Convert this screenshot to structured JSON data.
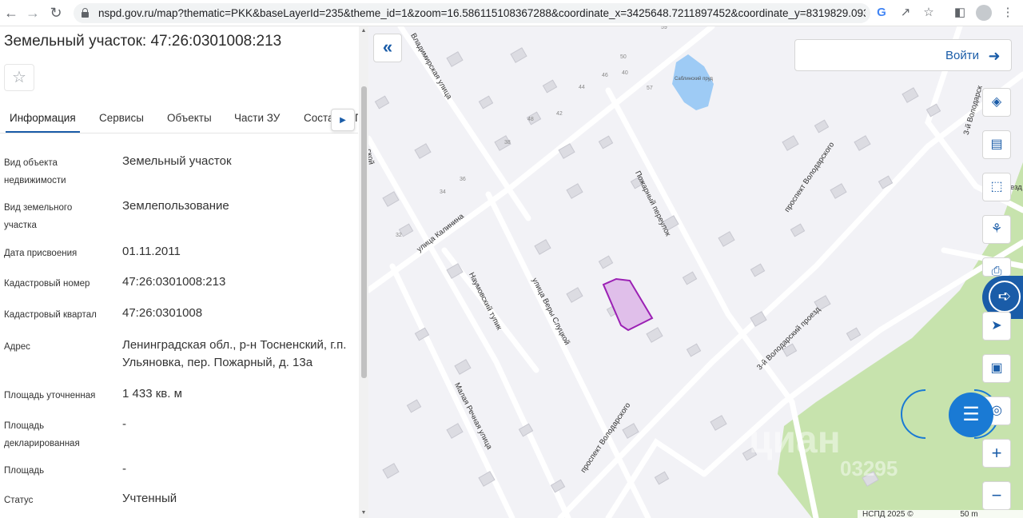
{
  "browser": {
    "url": "nspd.gov.ru/map?thematic=PKK&baseLayerId=235&theme_id=1&zoom=16.586115108367288&coordinate_x=3425648.7211897452&coordinate_y=8319829.093...",
    "back_icon": "arrow-left-icon",
    "forward_icon": "arrow-right-icon",
    "reload_icon": "reload-icon"
  },
  "panel": {
    "title": "Земельный участок: 47:26:0301008:213",
    "favorite_icon": "star-icon",
    "tabs": [
      {
        "label": "Информация",
        "active": true
      },
      {
        "label": "Сервисы",
        "active": false
      },
      {
        "label": "Объекты",
        "active": false
      },
      {
        "label": "Части ЗУ",
        "active": false
      },
      {
        "label": "Соста",
        "active": false
      },
      {
        "label": "П",
        "active": false
      }
    ],
    "properties": [
      {
        "label": "Вид объекта недвижимости",
        "value": "Земельный участок"
      },
      {
        "label": "Вид земельного участка",
        "value": "Землепользование"
      },
      {
        "label": "Дата присвоения",
        "value": "01.11.2011"
      },
      {
        "label": "Кадастровый номер",
        "value": "47:26:0301008:213"
      },
      {
        "label": "Кадастровый квартал",
        "value": "47:26:0301008"
      },
      {
        "label": "Адрес",
        "value": "Ленинградская обл., р-н Тосненский, г.п. Ульяновка, пер. Пожарный, д. 13а"
      },
      {
        "label": "Площадь уточненная",
        "value": "1 433 кв. м"
      },
      {
        "label": "Площадь декларированная",
        "value": "-"
      },
      {
        "label": "Площадь",
        "value": "-"
      },
      {
        "label": "Статус",
        "value": "Учтенный"
      }
    ]
  },
  "map": {
    "login_label": "Войти",
    "streets": {
      "kalinina": "улица Калинина",
      "pozharny": "Пожарный переулок",
      "volodarskogo_prospect_top": "проспект Володарского",
      "volodarskogo_prospect_bottom": "проспект Володарского",
      "naumovsky": "Наумовский тупик",
      "very_slutskoy": "улица Веры Слуцкой",
      "malaya_rechnaya": "Малая Речная улица",
      "volodarsky_proezd": "3-й Володарский проезд",
      "volodarskaya_3": "3-й Володарск",
      "vladimirskaya": "Владимирская улица",
      "pond": "Саблинский пруд",
      "left_edge": "ской",
      "right_edge": "езд"
    },
    "house_numbers": [
      "59",
      "50",
      "48",
      "46",
      "44",
      "42",
      "40",
      "38",
      "36",
      "34",
      "32",
      "57"
    ],
    "footer": "НСПД 2025 ©",
    "scale": "50 m",
    "watermark": "циан",
    "watermark_code": "03295",
    "colors": {
      "accent": "#1a5ca8",
      "parcel_fill": "#e0bfea",
      "parcel_stroke": "#9b20b4",
      "forest": "#c7e3ad",
      "water": "#9ecbf5"
    }
  }
}
